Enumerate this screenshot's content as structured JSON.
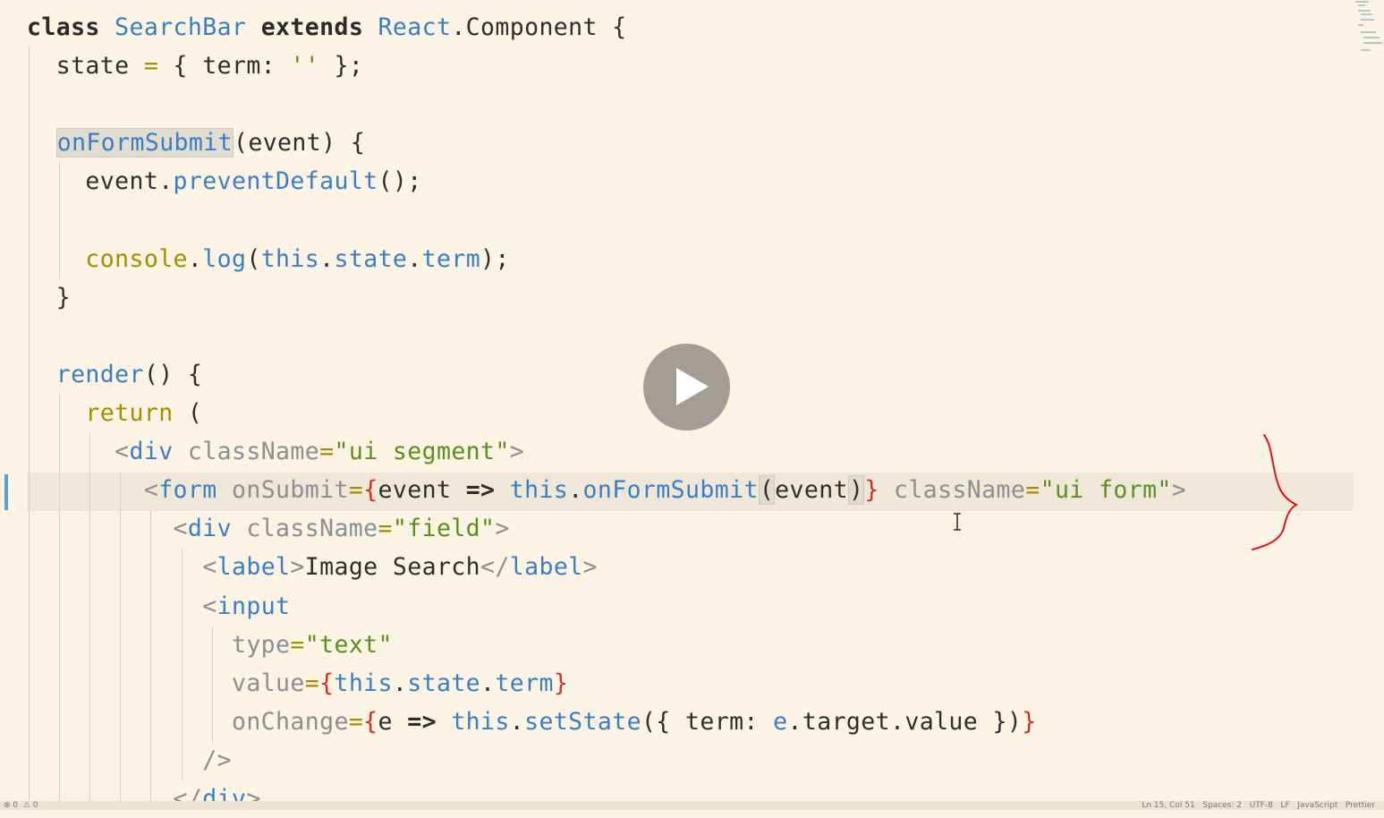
{
  "editor": {
    "lines": [
      [
        {
          "t": "class ",
          "c": "kw"
        },
        {
          "t": "SearchBar ",
          "c": "ent"
        },
        {
          "t": "extends ",
          "c": "kw"
        },
        {
          "t": "React",
          "c": "ent"
        },
        {
          "t": ".Component {",
          "c": ""
        }
      ],
      [
        {
          "t": "  state ",
          "c": ""
        },
        {
          "t": "=",
          "c": "yel"
        },
        {
          "t": " { term: ",
          "c": ""
        },
        {
          "t": "''",
          "c": "str"
        },
        {
          "t": " };",
          "c": ""
        }
      ],
      [],
      [
        {
          "t": "  ",
          "c": ""
        },
        {
          "t": "onFormSubmit",
          "c": "fn hlbox"
        },
        {
          "t": "(event) {",
          "c": ""
        }
      ],
      [
        {
          "t": "    event.",
          "c": ""
        },
        {
          "t": "preventDefault",
          "c": "fn"
        },
        {
          "t": "();",
          "c": ""
        }
      ],
      [],
      [
        {
          "t": "    ",
          "c": ""
        },
        {
          "t": "console",
          "c": "yel"
        },
        {
          "t": ".",
          "c": ""
        },
        {
          "t": "log",
          "c": "fn"
        },
        {
          "t": "(",
          "c": ""
        },
        {
          "t": "this",
          "c": "ent"
        },
        {
          "t": ".",
          "c": ""
        },
        {
          "t": "state",
          "c": "ent"
        },
        {
          "t": ".",
          "c": ""
        },
        {
          "t": "term",
          "c": "ent"
        },
        {
          "t": ");",
          "c": ""
        }
      ],
      [
        {
          "t": "  }",
          "c": ""
        }
      ],
      [],
      [
        {
          "t": "  ",
          "c": ""
        },
        {
          "t": "render",
          "c": "fn"
        },
        {
          "t": "() {",
          "c": ""
        }
      ],
      [
        {
          "t": "    ",
          "c": ""
        },
        {
          "t": "return",
          "c": "yel"
        },
        {
          "t": " (",
          "c": ""
        }
      ],
      [
        {
          "t": "      ",
          "c": ""
        },
        {
          "t": "<",
          "c": "pun"
        },
        {
          "t": "div ",
          "c": "tag"
        },
        {
          "t": "className",
          "c": "attr"
        },
        {
          "t": "=",
          "c": "yel"
        },
        {
          "t": "\"ui segment\"",
          "c": "str"
        },
        {
          "t": ">",
          "c": "pun"
        }
      ],
      [
        {
          "t": "        ",
          "c": ""
        },
        {
          "t": "<",
          "c": "pun"
        },
        {
          "t": "form ",
          "c": "tag"
        },
        {
          "t": "onSubmit",
          "c": "attr"
        },
        {
          "t": "=",
          "c": "yel"
        },
        {
          "t": "{",
          "c": "brace"
        },
        {
          "t": "event ",
          "c": ""
        },
        {
          "t": "=>",
          "c": "kw"
        },
        {
          "t": " ",
          "c": ""
        },
        {
          "t": "this",
          "c": "ent"
        },
        {
          "t": ".",
          "c": ""
        },
        {
          "t": "onFormSubmit",
          "c": "fn"
        },
        {
          "t": "(",
          "c": "hlbox"
        },
        {
          "t": "event",
          "c": ""
        },
        {
          "t": ")",
          "c": "hlbox"
        },
        {
          "t": "}",
          "c": "brace"
        },
        {
          "t": " ",
          "c": ""
        },
        {
          "t": "className",
          "c": "attr"
        },
        {
          "t": "=",
          "c": "yel"
        },
        {
          "t": "\"ui form\"",
          "c": "str"
        },
        {
          "t": ">",
          "c": "pun"
        }
      ],
      [
        {
          "t": "          ",
          "c": ""
        },
        {
          "t": "<",
          "c": "pun"
        },
        {
          "t": "div ",
          "c": "tag"
        },
        {
          "t": "className",
          "c": "attr"
        },
        {
          "t": "=",
          "c": "yel"
        },
        {
          "t": "\"field\"",
          "c": "str"
        },
        {
          "t": ">",
          "c": "pun"
        }
      ],
      [
        {
          "t": "            ",
          "c": ""
        },
        {
          "t": "<",
          "c": "pun"
        },
        {
          "t": "label",
          "c": "tag"
        },
        {
          "t": ">",
          "c": "pun"
        },
        {
          "t": "Image Search",
          "c": ""
        },
        {
          "t": "</",
          "c": "pun"
        },
        {
          "t": "label",
          "c": "tag"
        },
        {
          "t": ">",
          "c": "pun"
        }
      ],
      [
        {
          "t": "            ",
          "c": ""
        },
        {
          "t": "<",
          "c": "pun"
        },
        {
          "t": "input",
          "c": "tag"
        }
      ],
      [
        {
          "t": "              ",
          "c": ""
        },
        {
          "t": "type",
          "c": "attr"
        },
        {
          "t": "=",
          "c": "yel"
        },
        {
          "t": "\"text\"",
          "c": "str"
        }
      ],
      [
        {
          "t": "              ",
          "c": ""
        },
        {
          "t": "value",
          "c": "attr"
        },
        {
          "t": "=",
          "c": "yel"
        },
        {
          "t": "{",
          "c": "brace"
        },
        {
          "t": "this",
          "c": "ent"
        },
        {
          "t": ".",
          "c": ""
        },
        {
          "t": "state",
          "c": "ent"
        },
        {
          "t": ".",
          "c": ""
        },
        {
          "t": "term",
          "c": "ent"
        },
        {
          "t": "}",
          "c": "brace"
        }
      ],
      [
        {
          "t": "              ",
          "c": ""
        },
        {
          "t": "onChange",
          "c": "attr"
        },
        {
          "t": "=",
          "c": "yel"
        },
        {
          "t": "{",
          "c": "brace"
        },
        {
          "t": "e ",
          "c": ""
        },
        {
          "t": "=>",
          "c": "kw"
        },
        {
          "t": " ",
          "c": ""
        },
        {
          "t": "this",
          "c": "ent"
        },
        {
          "t": ".",
          "c": ""
        },
        {
          "t": "setState",
          "c": "fn"
        },
        {
          "t": "({ term: ",
          "c": ""
        },
        {
          "t": "e",
          "c": "ent"
        },
        {
          "t": ".target.value })",
          "c": ""
        },
        {
          "t": "}",
          "c": "brace"
        }
      ],
      [
        {
          "t": "            ",
          "c": ""
        },
        {
          "t": "/>",
          "c": "pun"
        }
      ],
      [
        {
          "t": "          ",
          "c": ""
        },
        {
          "t": "</",
          "c": "pun"
        },
        {
          "t": "div",
          "c": "tag"
        },
        {
          "t": ">",
          "c": "pun"
        }
      ]
    ]
  },
  "statusbar": {
    "left": "⊗ 0  ⚠ 0",
    "right": "Ln 15, Col 51   Spaces: 2   UTF-8   LF   JavaScript   Prettier"
  },
  "video": {
    "play_label": "Play video"
  }
}
